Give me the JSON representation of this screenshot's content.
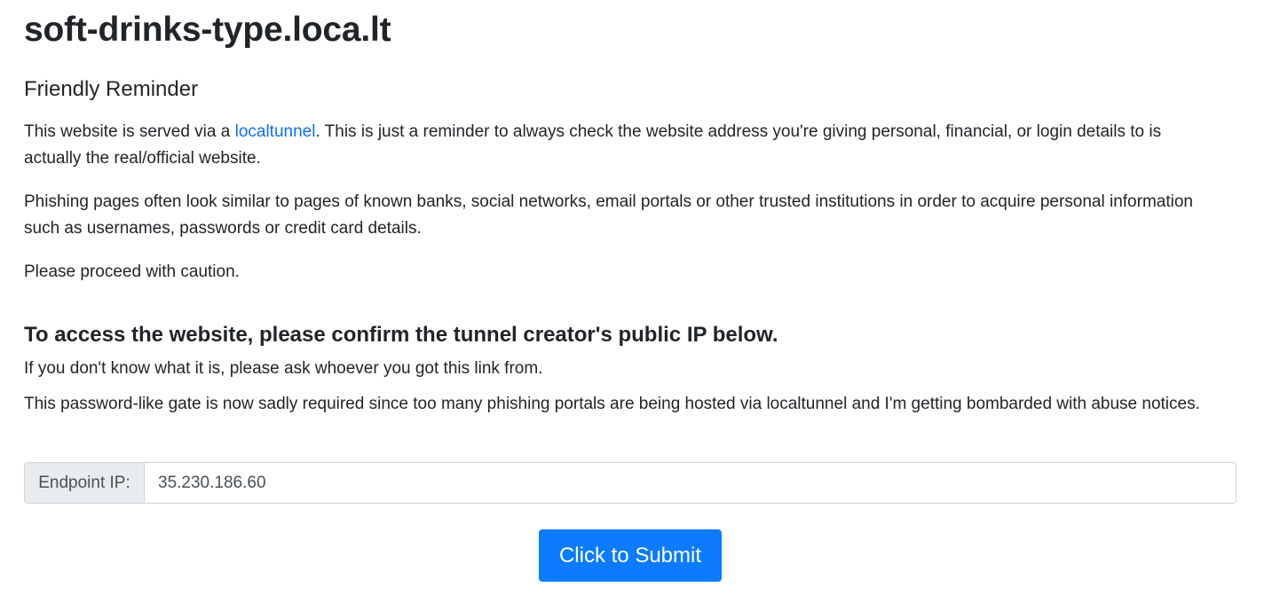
{
  "page": {
    "title": "soft-drinks-type.loca.lt"
  },
  "reminder": {
    "heading": "Friendly Reminder",
    "p1_before": "This website is served via a ",
    "p1_link": "localtunnel",
    "p1_after": ". This is just a reminder to always check the website address you're giving personal, financial, or login details to is actually the real/official website.",
    "p2": "Phishing pages often look similar to pages of known banks, social networks, email portals or other trusted institutions in order to acquire personal information such as usernames, passwords or credit card details.",
    "p3": "Please proceed with caution."
  },
  "access": {
    "heading": "To access the website, please confirm the tunnel creator's public IP below.",
    "p1": "If you don't know what it is, please ask whoever you got this link from.",
    "p2": "This password-like gate is now sadly required since too many phishing portals are being hosted via localtunnel and I'm getting bombarded with abuse notices."
  },
  "form": {
    "label": "Endpoint IP:",
    "value": "35.230.186.60",
    "submit_label": "Click to Submit"
  },
  "colors": {
    "link": "#0d6efd",
    "button": "#0d7bff"
  }
}
